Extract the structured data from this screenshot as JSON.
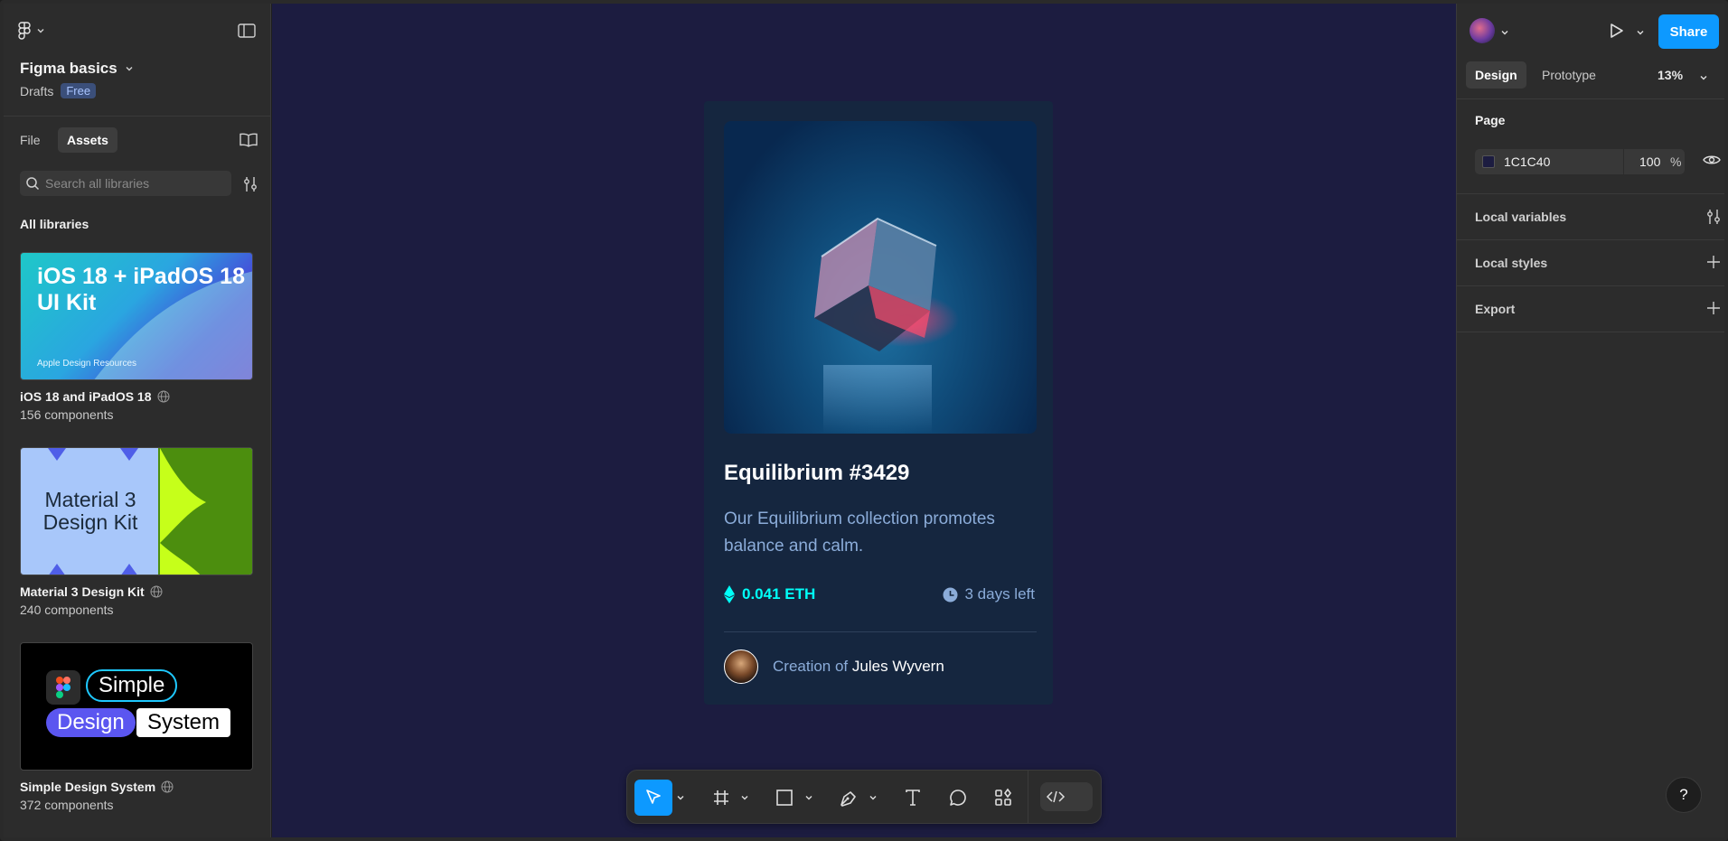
{
  "file": {
    "name": "Figma basics",
    "location": "Drafts",
    "plan_badge": "Free"
  },
  "left_tabs": [
    "File",
    "Assets"
  ],
  "search": {
    "placeholder": "Search all libraries"
  },
  "libraries": {
    "heading": "All libraries",
    "items": [
      {
        "name": "iOS 18 and iPadOS 18",
        "count": "156 components",
        "thumb_title": "iOS 18 + iPadOS 18 UI Kit",
        "thumb_sub": "Apple Design Resources"
      },
      {
        "name": "Material 3 Design Kit",
        "count": "240 components",
        "thumb_title": "Material 3 Design Kit"
      },
      {
        "name": "Simple Design System",
        "count": "372 components",
        "thumb_words": [
          "Simple",
          "Design",
          "System"
        ]
      }
    ]
  },
  "card": {
    "title": "Equilibrium #3429",
    "description": "Our Equilibrium collection promotes balance and calm.",
    "price": "0.041 ETH",
    "time_left": "3 days left",
    "creator_prefix": "Creation of",
    "creator_name": "Jules Wyvern"
  },
  "right": {
    "share_label": "Share",
    "tabs": [
      "Design",
      "Prototype"
    ],
    "zoom": "13%",
    "page_heading": "Page",
    "page_color": "1C1C40",
    "page_opacity": "100",
    "opacity_unit": "%",
    "sections": [
      "Local variables",
      "Local styles",
      "Export"
    ],
    "help": "?"
  },
  "colors": {
    "canvas": "#1c1c40",
    "card": "#15263f",
    "accent": "#0d99ff",
    "cyan": "#00fff8",
    "soft_blue": "#8bacd9"
  }
}
